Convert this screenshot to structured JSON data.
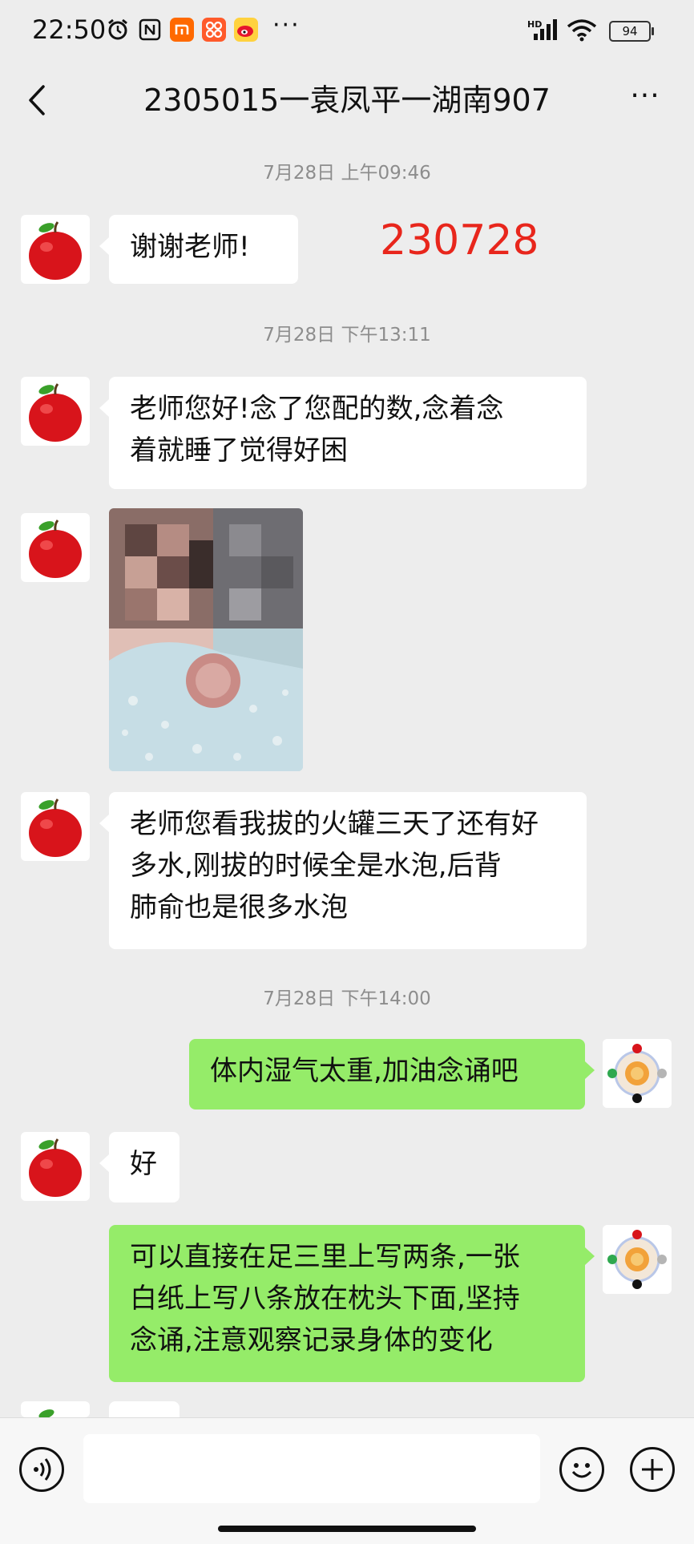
{
  "status_bar": {
    "time": "22:50",
    "battery": "94",
    "network": "HD",
    "more": "···",
    "icons": [
      "alarm-icon",
      "nfc-icon",
      "mi-icon",
      "app-icon",
      "weibo-icon",
      "signal-icon",
      "wifi-icon",
      "battery-icon"
    ]
  },
  "header": {
    "title": "2305015一袁凤平一湖南907",
    "back_icon": "chevron-left-icon",
    "more_icon": "more-dots-icon",
    "more": "···"
  },
  "annotation": {
    "text": "230728",
    "color": "#e8261c"
  },
  "timestamps": [
    "7月28日 上午09:46",
    "7月28日 下午13:11",
    "7月28日 下午14:00"
  ],
  "messages": [
    {
      "from": "contact",
      "type": "text",
      "text": "谢谢老师!"
    },
    {
      "from": "contact",
      "type": "text",
      "lines": [
        "老师您好!念了您配的数,念着念",
        "着就睡了觉得好困"
      ]
    },
    {
      "from": "contact",
      "type": "image",
      "description_icon": "photo-icon"
    },
    {
      "from": "contact",
      "type": "text",
      "lines": [
        "老师您看我拔的火罐三天了还有好",
        "多水,刚拔的时候全是水泡,后背",
        "肺俞也是很多水泡"
      ]
    },
    {
      "from": "self",
      "type": "text",
      "text": "体内湿气太重,加油念诵吧"
    },
    {
      "from": "contact",
      "type": "text",
      "text": "好"
    },
    {
      "from": "self",
      "type": "text",
      "lines": [
        "可以直接在足三里上写两条,一张",
        "白纸上写八条放在枕头下面,坚持",
        "念诵,注意观察记录身体的变化"
      ]
    }
  ],
  "input_bar": {
    "voice_icon": "voice-icon",
    "emoji_icon": "emoji-icon",
    "plus_icon": "plus-icon",
    "value": "",
    "placeholder": ""
  },
  "colors": {
    "self_bubble": "#95ec69",
    "contact_bubble": "#ffffff",
    "background": "#ededed",
    "annotation": "#e8261c"
  }
}
